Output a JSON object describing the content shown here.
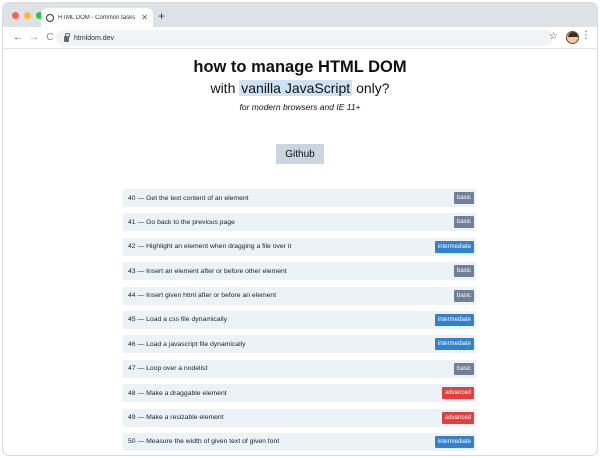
{
  "browser": {
    "tab_title": "HTML DOM - Common tasks of ma",
    "tab_close": "✕",
    "new_tab": "+",
    "back": "←",
    "forward": "→",
    "reload": "C",
    "url": "htmldom.dev",
    "bookmark": "☆",
    "menu": "⋮"
  },
  "header": {
    "title": "how to manage HTML DOM",
    "subtitle_prefix": "with ",
    "subtitle_highlight": "vanilla JavaScript",
    "subtitle_suffix": " only?",
    "tagline": "for modern browsers and IE 11+",
    "github_label": "Github"
  },
  "colors": {
    "basic": "#718096",
    "intermediate": "#3182ce",
    "advanced": "#e53e3e",
    "row_bg": "#edf2f7",
    "highlight": "#cfe2f3"
  },
  "items": [
    {
      "text": "40 — Get the text content of an element",
      "level": "basic"
    },
    {
      "text": "41 — Go back to the previous page",
      "level": "basic"
    },
    {
      "text": "42 — Highlight an element when dragging a file over it",
      "level": "intermediate"
    },
    {
      "text": "43 — Insert an element after or before other element",
      "level": "basic"
    },
    {
      "text": "44 — Insert given html after or before an element",
      "level": "basic"
    },
    {
      "text": "45 — Load a css file dynamically",
      "level": "intermediate"
    },
    {
      "text": "46 — Load a javascript file dynamically",
      "level": "intermediate"
    },
    {
      "text": "47 — Loop over a nodelist",
      "level": "basic"
    },
    {
      "text": "48 — Make a draggable element",
      "level": "advanced"
    },
    {
      "text": "49 — Make a resizable element",
      "level": "advanced"
    },
    {
      "text": "50 — Measure the width of given text of given font",
      "level": "intermediate"
    }
  ]
}
